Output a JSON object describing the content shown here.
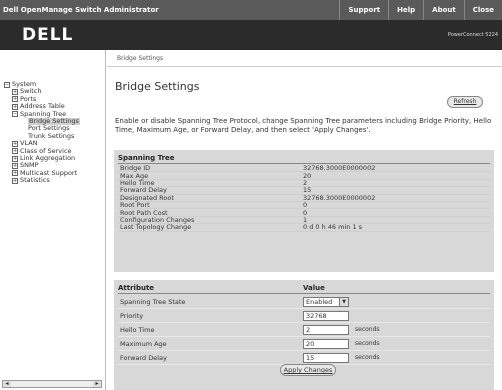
{
  "header": {
    "title": "Dell OpenManage Switch Administrator",
    "links": [
      "Support",
      "Help",
      "About",
      "Close"
    ]
  },
  "banner": {
    "logo": "DELL",
    "model": "PowerConnect 5224"
  },
  "nav": {
    "items": [
      {
        "label": "System",
        "toggle": "−",
        "indent": 0
      },
      {
        "label": "Switch",
        "toggle": "+",
        "indent": 1
      },
      {
        "label": "Ports",
        "toggle": "+",
        "indent": 1
      },
      {
        "label": "Address Table",
        "toggle": "+",
        "indent": 1
      },
      {
        "label": "Spanning Tree",
        "toggle": "−",
        "indent": 1
      },
      {
        "label": "Bridge Settings",
        "toggle": "",
        "indent": 2,
        "selected": true
      },
      {
        "label": "Port Settings",
        "toggle": "",
        "indent": 2
      },
      {
        "label": "Trunk Settings",
        "toggle": "",
        "indent": 2
      },
      {
        "label": "VLAN",
        "toggle": "+",
        "indent": 1
      },
      {
        "label": "Class of Service",
        "toggle": "+",
        "indent": 1
      },
      {
        "label": "Link Aggregation",
        "toggle": "+",
        "indent": 1
      },
      {
        "label": "SNMP",
        "toggle": "+",
        "indent": 1
      },
      {
        "label": "Multicast Support",
        "toggle": "+",
        "indent": 1
      },
      {
        "label": "Statistics",
        "toggle": "+",
        "indent": 1
      }
    ]
  },
  "main": {
    "breadcrumb": "Bridge Settings",
    "title": "Bridge Settings",
    "refresh_label": "Refresh",
    "description": "Enable or disable Spanning Tree Protocol, change Spanning Tree parameters including Bridge Priority, Hello Time, Maximum Age, or Forward Delay, and then select 'Apply Changes'.",
    "status_table": {
      "header": "Spanning Tree",
      "rows": [
        {
          "key": "Bridge ID",
          "value": "32768.3000E0000002"
        },
        {
          "key": "Max Age",
          "value": "20"
        },
        {
          "key": "Hello Time",
          "value": "2"
        },
        {
          "key": "Forward Delay",
          "value": "15"
        },
        {
          "key": "Designated Root",
          "value": "32768.3000E0000002"
        },
        {
          "key": "Root Port",
          "value": "0"
        },
        {
          "key": "Root Path Cost",
          "value": "0"
        },
        {
          "key": "Configuration Changes",
          "value": "1"
        },
        {
          "key": "Last Topology Change",
          "value": "0 d 0 h 46 min 1 s"
        }
      ]
    },
    "settings_table": {
      "header_attr": "Attribute",
      "header_value": "Value",
      "stp_state_label": "Spanning Tree State",
      "stp_state_value": "Enabled",
      "priority_label": "Priority",
      "priority_value": "32768",
      "hello_label": "Hello Time",
      "hello_value": "2",
      "maxage_label": "Maximum Age",
      "maxage_value": "20",
      "fwd_label": "Forward Delay",
      "fwd_value": "15",
      "unit": "seconds"
    },
    "apply_label": "Apply Changes"
  }
}
